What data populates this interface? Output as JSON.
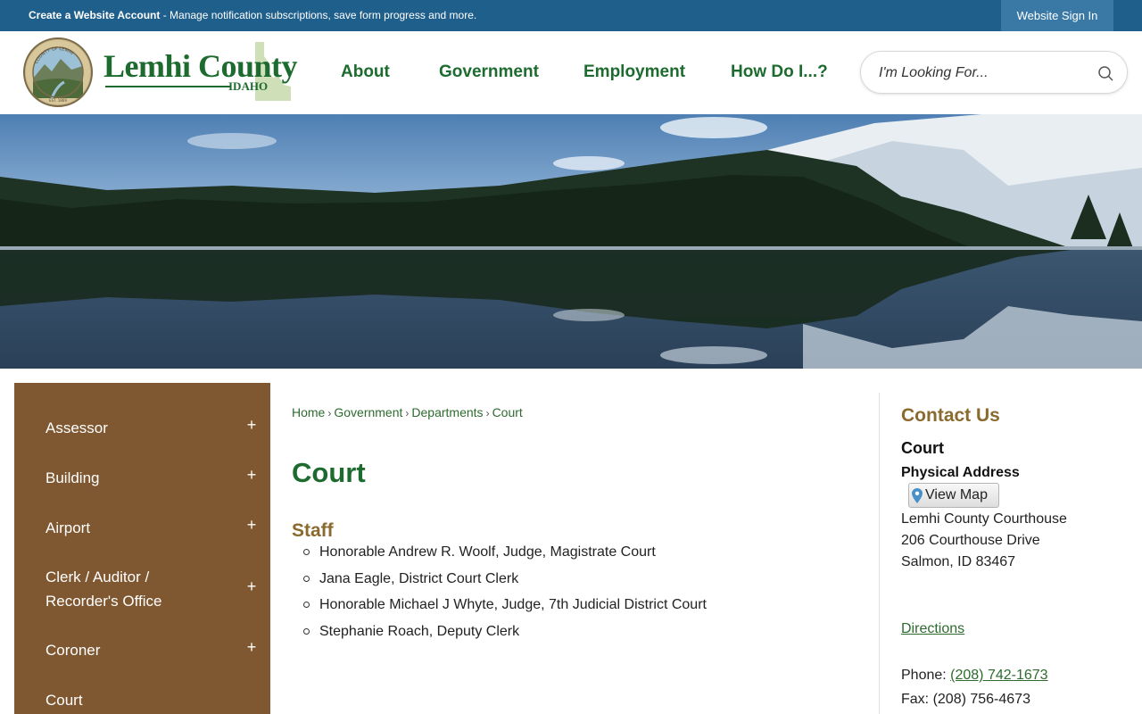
{
  "topbar": {
    "account_link": "Create a Website Account",
    "account_desc": " - Manage notification subscriptions, save form progress and more.",
    "signin": "Website Sign In"
  },
  "brand": {
    "name": "Lemhi County",
    "state": "IDAHO",
    "seal_top_text": "COUNTY OF LEMHI",
    "seal_bottom_text": "EST. 1869"
  },
  "nav": {
    "items": [
      {
        "label": "About"
      },
      {
        "label": "Government"
      },
      {
        "label": "Employment"
      },
      {
        "label": "How Do I...?"
      }
    ]
  },
  "search": {
    "placeholder": "I'm Looking For..."
  },
  "sidebar": {
    "items": [
      {
        "label": "Assessor",
        "toggle": "+"
      },
      {
        "label": "Building",
        "toggle": "+"
      },
      {
        "label": "Airport",
        "toggle": "+"
      },
      {
        "label": "Clerk / Auditor / Recorder's Office",
        "toggle": "+"
      },
      {
        "label": "Coroner",
        "toggle": "+"
      },
      {
        "label": "Court"
      }
    ]
  },
  "breadcrumb": {
    "items": [
      "Home",
      "Government",
      "Departments",
      "Court"
    ],
    "separator": "›"
  },
  "main": {
    "title": "Court",
    "staff_heading": "Staff",
    "staff": [
      "Honorable Andrew R. Woolf, Judge, Magistrate Court",
      "Jana Eagle, District Court Clerk",
      "Honorable Michael J Whyte, Judge, 7th Judicial District Court",
      "Stephanie Roach, Deputy Clerk"
    ]
  },
  "contact": {
    "heading": "Contact Us",
    "name": "Court",
    "address_label": "Physical Address",
    "map_button": "View Map",
    "address_lines": [
      "Lemhi County Courthouse",
      "206 Courthouse Drive",
      "Salmon, ID 83467"
    ],
    "directions": "Directions",
    "phone_label": "Phone: ",
    "phone": "(208) 742-1673",
    "fax_label": "Fax: ",
    "fax": "(208) 756-4673"
  },
  "colors": {
    "topbar": "#1f5f8b",
    "brand_green": "#1d6b2e",
    "sidebar_brown": "#7f5730",
    "heading_gold": "#8a6a2f"
  }
}
